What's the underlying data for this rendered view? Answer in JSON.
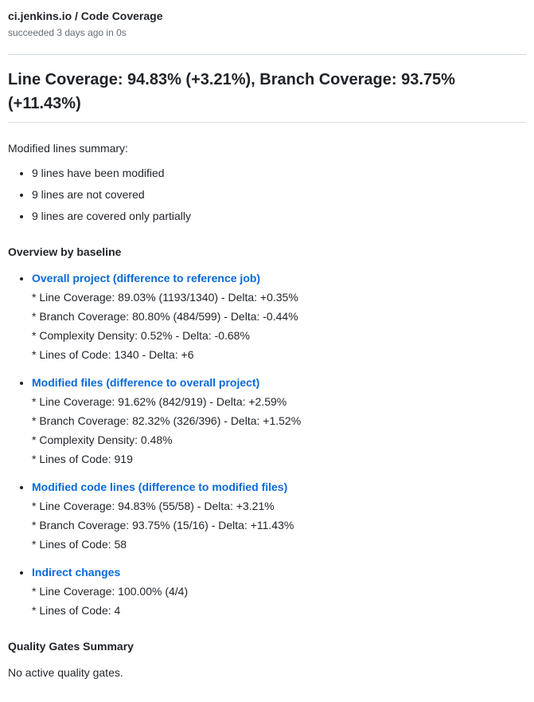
{
  "header": {
    "source": "ci.jenkins.io / Code Coverage",
    "status": "succeeded 3 days ago in 0s"
  },
  "title": "Line Coverage: 94.83% (+3.21%), Branch Coverage: 93.75% (+11.43%)",
  "summary_intro": "Modified lines summary:",
  "summary_items": [
    "9 lines have been modified",
    "9 lines are not covered",
    "9 lines are covered only partially"
  ],
  "overview_heading": "Overview by baseline",
  "baselines": [
    {
      "title": "Overall project (difference to reference job)",
      "metrics": [
        "* Line Coverage: 89.03% (1193/1340) - Delta: +0.35%",
        "* Branch Coverage: 80.80% (484/599) - Delta: -0.44%",
        "* Complexity Density: 0.52% - Delta: -0.68%",
        "* Lines of Code: 1340 - Delta: +6"
      ]
    },
    {
      "title": "Modified files (difference to overall project)",
      "metrics": [
        "* Line Coverage: 91.62% (842/919) - Delta: +2.59%",
        "* Branch Coverage: 82.32% (326/396) - Delta: +1.52%",
        "* Complexity Density: 0.48%",
        "* Lines of Code: 919"
      ]
    },
    {
      "title": "Modified code lines (difference to modified files)",
      "metrics": [
        "* Line Coverage: 94.83% (55/58) - Delta: +3.21%",
        "* Branch Coverage: 93.75% (15/16) - Delta: +11.43%",
        "* Lines of Code: 58"
      ]
    },
    {
      "title": "Indirect changes",
      "metrics": [
        "* Line Coverage: 100.00% (4/4)",
        "* Lines of Code: 4"
      ]
    }
  ],
  "gates_heading": "Quality Gates Summary",
  "gates_text": "No active quality gates."
}
